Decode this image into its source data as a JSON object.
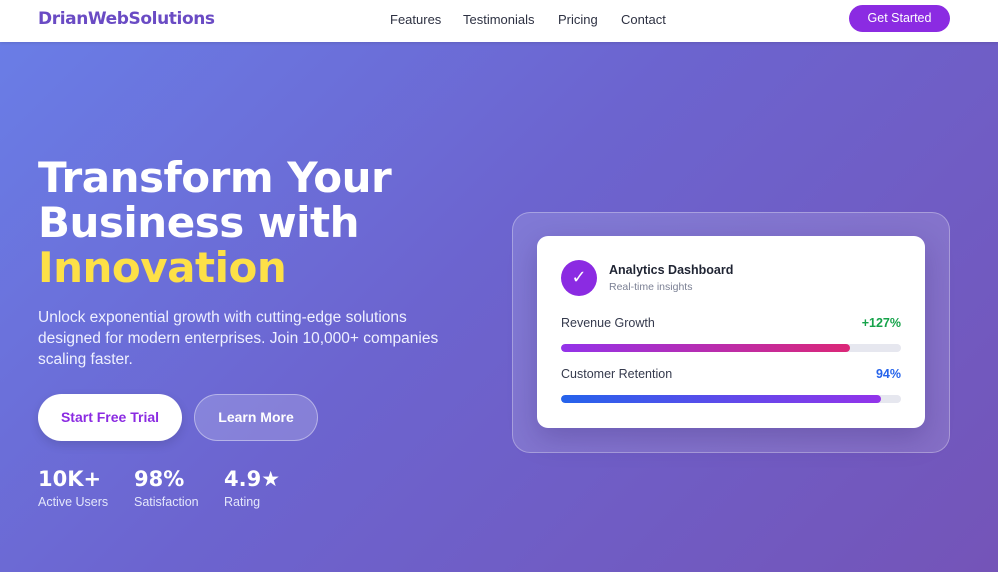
{
  "nav": {
    "brand": "DrianWebSolutions",
    "links": [
      "Features",
      "Testimonials",
      "Pricing",
      "Contact"
    ],
    "cta_label": "Get Started"
  },
  "hero": {
    "headline_line1": "Transform Your",
    "headline_line2": "Business with",
    "headline_accent": "Innovation",
    "subtitle": "Unlock exponential growth with cutting-edge solutions designed for modern enterprises. Join 10,000+ companies scaling faster.",
    "primary_button": "Start Free Trial",
    "secondary_button": "Learn More",
    "stats": [
      {
        "value": "10K+",
        "label": "Active Users"
      },
      {
        "value": "98%",
        "label": "Satisfaction"
      },
      {
        "value": "4.9★",
        "label": "Rating"
      }
    ]
  },
  "dashboard": {
    "icon": "checkmark-icon",
    "icon_glyph": "✓",
    "title": "Analytics Dashboard",
    "subtitle": "Real-time insights",
    "metrics": [
      {
        "label": "Revenue Growth",
        "value": "+127%",
        "fill_fraction": 0.85,
        "value_color": "#16a34a",
        "bar_gradient": [
          "#9333ea",
          "#db2777"
        ]
      },
      {
        "label": "Customer Retention",
        "value": "94%",
        "fill_fraction": 0.94,
        "value_color": "#2563eb",
        "bar_gradient": [
          "#2563eb",
          "#9333ea"
        ]
      }
    ]
  },
  "colors": {
    "brand": "#6a4bc4",
    "accent_purple": "#8b2be2",
    "accent_yellow": "#fde047",
    "hero_gradient": [
      "#6a7de6",
      "#7454b8"
    ]
  }
}
